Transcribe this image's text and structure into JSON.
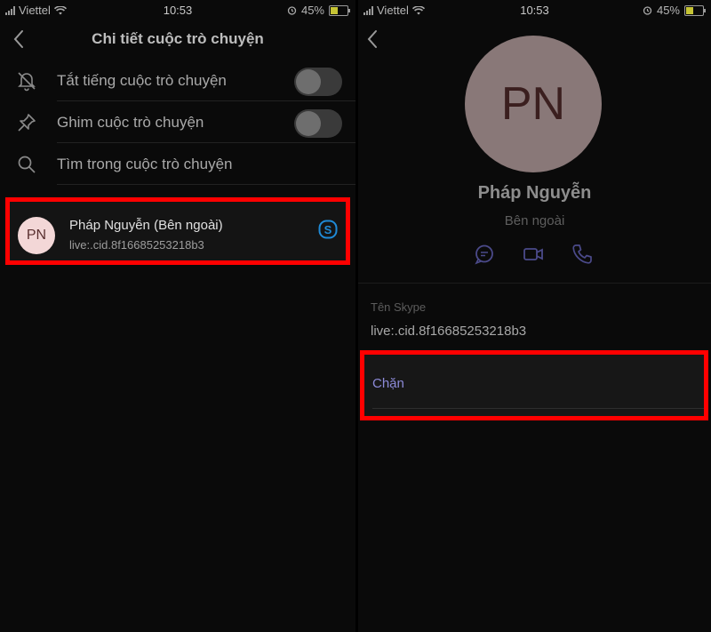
{
  "status_bar": {
    "carrier": "Viettel",
    "time": "10:53",
    "battery_percent": "45%",
    "battery_level": 0.45
  },
  "left_screen": {
    "title": "Chi tiết cuộc trò chuyện",
    "settings": [
      {
        "label": "Tắt tiếng cuộc trò chuyện",
        "icon": "bell-off-icon",
        "toggle": false
      },
      {
        "label": "Ghim cuộc trò chuyện",
        "icon": "pin-icon",
        "toggle": false
      },
      {
        "label": "Tìm trong cuộc trò chuyện",
        "icon": "search-icon"
      }
    ],
    "contact": {
      "initials": "PN",
      "name": "Pháp Nguyễn (Bên ngoài)",
      "id": "live:.cid.8f16685253218b3",
      "service_icon": "skype-icon"
    }
  },
  "right_screen": {
    "profile": {
      "initials": "PN",
      "name": "Pháp Nguyễn",
      "subtitle": "Bên ngoài"
    },
    "actions": [
      "chat-icon",
      "video-icon",
      "phone-icon"
    ],
    "skype_name_label": "Tên Skype",
    "skype_name_value": "live:.cid.8f16685253218b3",
    "block_label": "Chặn"
  },
  "colors": {
    "highlight": "#ff0000",
    "accent": "#8c8ad8",
    "skype": "#1f8ad6"
  }
}
